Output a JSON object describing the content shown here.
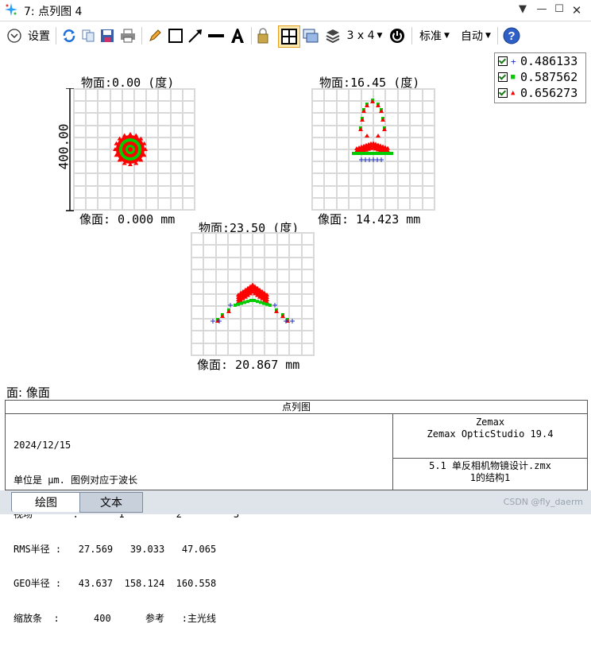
{
  "window": {
    "title": "7: 点列图 4"
  },
  "toolbar": {
    "settings_label": "设置",
    "layout_label": "3 x 4",
    "standard_label": "标准",
    "auto_label": "自动"
  },
  "legend": [
    {
      "label": "0.486133",
      "marker": "+",
      "color": "#1f2fbf"
    },
    {
      "label": "0.587562",
      "marker": "■",
      "color": "#00cc00"
    },
    {
      "label": "0.656273",
      "marker": "▲",
      "color": "#ff0000"
    }
  ],
  "plots": [
    {
      "object_label": "物面:0.00 (度)",
      "image_label": "像面: 0.000 mm"
    },
    {
      "object_label": "物面:16.45 (度)",
      "image_label": "像面: 14.423 mm"
    },
    {
      "object_label": "物面:23.50 (度)",
      "image_label": "像面: 20.867 mm"
    }
  ],
  "scale_label": "400.00",
  "surface_label": "面: 像面",
  "info": {
    "header": "点列图",
    "date": "2024/12/15",
    "units_line": "单位是 μm. 图例对应于波长",
    "field_line": "视场       :       1         2         3",
    "rms_line": "RMS半径 :   27.569   39.033   47.065",
    "geo_line": "GEO半径 :   43.637  158.124  160.558",
    "scale_line": "缩放条  :      400      参考   :主光线",
    "software": "Zemax",
    "software_version": "Zemax OpticStudio 19.4",
    "file_line": "5.1 单反相机物镜设计.zmx",
    "config_line": "1的结构1"
  },
  "tabs": [
    {
      "label": "绘图"
    },
    {
      "label": "文本"
    }
  ],
  "watermark": "CSDN @fly_daerm",
  "colors": {
    "green": "#00cc00",
    "red": "#ff0000",
    "blue": "#1f2fbf",
    "grid": "#d9d9d9"
  }
}
